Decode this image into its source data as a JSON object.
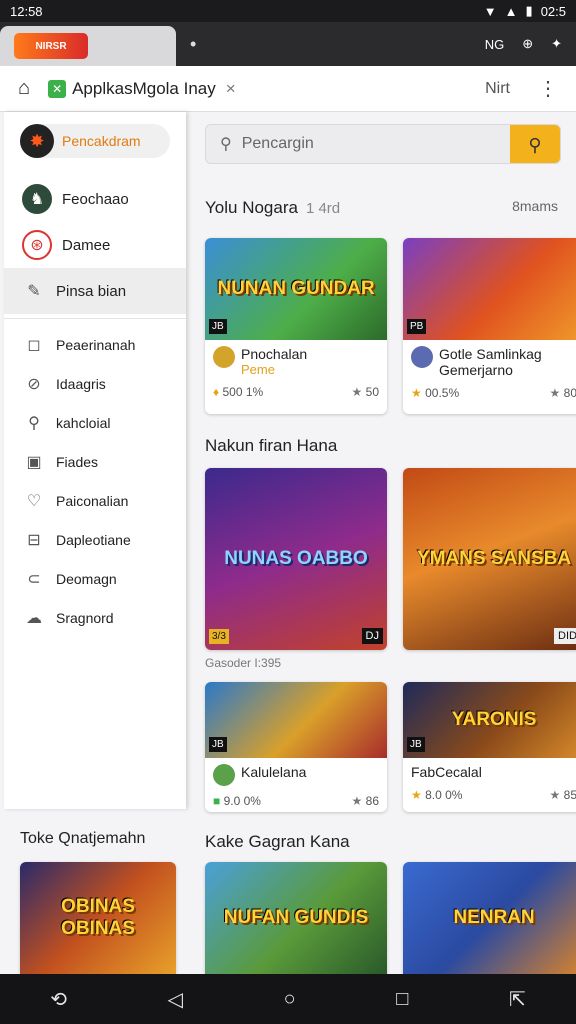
{
  "status": {
    "time": "12:58",
    "battery": "02:5"
  },
  "tabbar": {
    "logo_text": "NIRSR",
    "tab_dot": "•",
    "action1": "NG",
    "action2": "⊕"
  },
  "urlbar": {
    "title": "ApplkasMgola Inay",
    "favicon": "✕",
    "close": "×",
    "next": "Nirt",
    "menu": "⋮"
  },
  "sidebar": {
    "top_label": "Pencakdram",
    "items": [
      {
        "label": "Feochaao",
        "icon": "♞"
      },
      {
        "label": "Damee",
        "icon": "⊛"
      },
      {
        "label": "Pinsa bian",
        "icon": "✎"
      },
      {
        "label": "Peaerinanah",
        "icon": "◻"
      },
      {
        "label": "Idaagris",
        "icon": "⊘"
      },
      {
        "label": "kahcloial",
        "icon": "⚲"
      },
      {
        "label": "Fiades",
        "icon": "▣"
      },
      {
        "label": "Paiconalian",
        "icon": "♡"
      },
      {
        "label": "Dapleotiane",
        "icon": "⊟"
      },
      {
        "label": "Deomagn",
        "icon": "⊂"
      },
      {
        "label": "Sragnord",
        "icon": "☁"
      }
    ]
  },
  "search": {
    "placeholder": "Pencargin"
  },
  "sections": {
    "s1_title": "Yolu Nogara",
    "s1_sub": "1 4rd",
    "s1_right": "8mams",
    "s2_title": "Nakun firan Hana",
    "s3_left": "Toke Qnatjemahn",
    "s3_title": "Kake Gagran Kana"
  },
  "cards_row1": [
    {
      "art": "NUNAN GUNDAR",
      "badge_l": "JB",
      "title": "Pnochalan",
      "sub": "Peme",
      "stat_l": "500 1%",
      "stat_r": "50"
    },
    {
      "art": "",
      "badge_l": "PB",
      "title": "Gotle Samlinkag Gemerjarno",
      "sub": "",
      "stat_l": "00.5%",
      "stat_r": "80"
    }
  ],
  "cards_row2": [
    {
      "art": "NUNAS OABBO",
      "badge_l": "3/3",
      "badge_r": "DJ"
    },
    {
      "art": "YMANS SANSBA",
      "badge_r": "DID"
    }
  ],
  "caption": "Gasoder I:395",
  "cards_row3": [
    {
      "art": "",
      "badge_l": "JB",
      "title": "Kalulelana",
      "stat_l": "9.0 0%",
      "stat_r": "86"
    },
    {
      "art": "YARONIS",
      "badge_l": "JB",
      "title": "FabCecalal",
      "stat_l": "8.0 0%",
      "stat_r": "85"
    }
  ],
  "cards_row4": [
    {
      "art": "OBINAS OBINAS"
    },
    {
      "art": "NUFAN GUNDIS"
    },
    {
      "art": "NENRAN"
    }
  ],
  "nav": {
    "back": "⟲",
    "tri": "◁",
    "home": "○",
    "recent": "□",
    "extra": "⇱"
  }
}
